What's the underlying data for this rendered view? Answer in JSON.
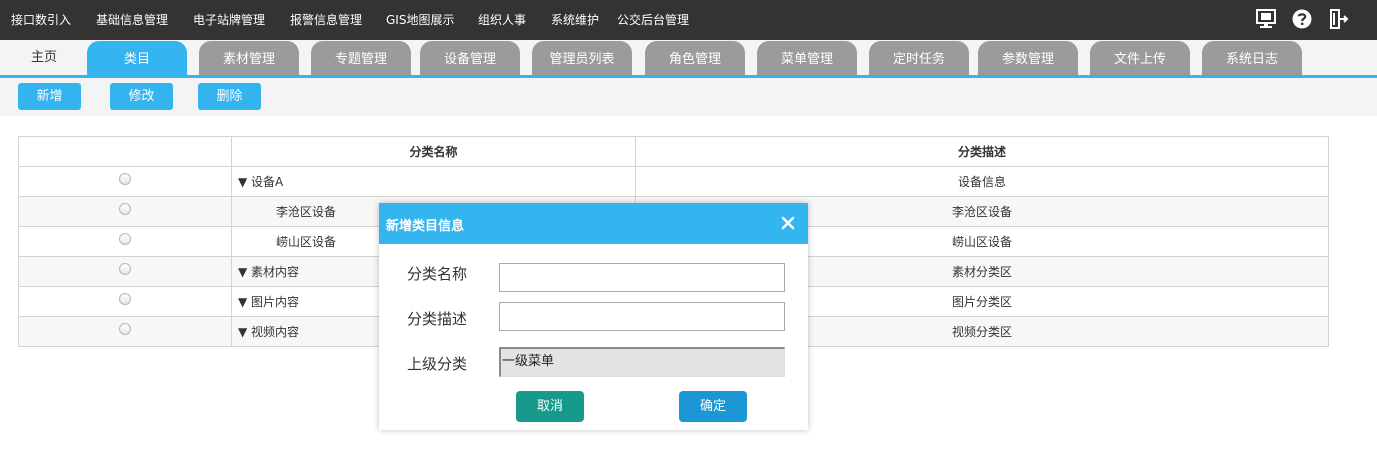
{
  "topnav": {
    "items": [
      "接口数引入",
      "基础信息管理",
      "电子站牌管理",
      "报警信息管理",
      "GIS地图展示",
      "组织人事",
      "系统维护",
      "公交后台管理"
    ],
    "icons": [
      "monitor-icon",
      "help-icon",
      "logout-icon"
    ]
  },
  "tabs": {
    "home": "主页",
    "items": [
      "类目",
      "素材管理",
      "专题管理",
      "设备管理",
      "管理员列表",
      "角色管理",
      "菜单管理",
      "定时任务",
      "参数管理",
      "文件上传",
      "系统日志"
    ],
    "active_index": 0
  },
  "toolbar": {
    "add_label": "新增",
    "edit_label": "修改",
    "delete_label": "删除"
  },
  "table": {
    "headers": [
      "",
      "分类名称",
      "分类描述"
    ],
    "rows": [
      {
        "name": "▼ 设备A",
        "desc": "设备信息",
        "child": false
      },
      {
        "name": "李沧区设备",
        "desc": "李沧区设备",
        "child": true
      },
      {
        "name": "崂山区设备",
        "desc": "崂山区设备",
        "child": true
      },
      {
        "name": "▼ 素材内容",
        "desc": "素材分类区",
        "child": false
      },
      {
        "name": "▼ 图片内容",
        "desc": "图片分类区",
        "child": false
      },
      {
        "name": "▼ 视频内容",
        "desc": "视频分类区",
        "child": false
      }
    ]
  },
  "dialog": {
    "title": "新增类目信息",
    "name_label": "分类名称",
    "name_value": "",
    "desc_label": "分类描述",
    "desc_value": "",
    "parent_label": "上级分类",
    "parent_value": "一级菜单",
    "cancel_label": "取消",
    "ok_label": "确定"
  },
  "colors": {
    "topbar": "#333333",
    "accent": "#35b5f0",
    "tab_inactive": "#9b9b9b",
    "cancel_button": "#17998c",
    "ok_button": "#1a97d4"
  }
}
